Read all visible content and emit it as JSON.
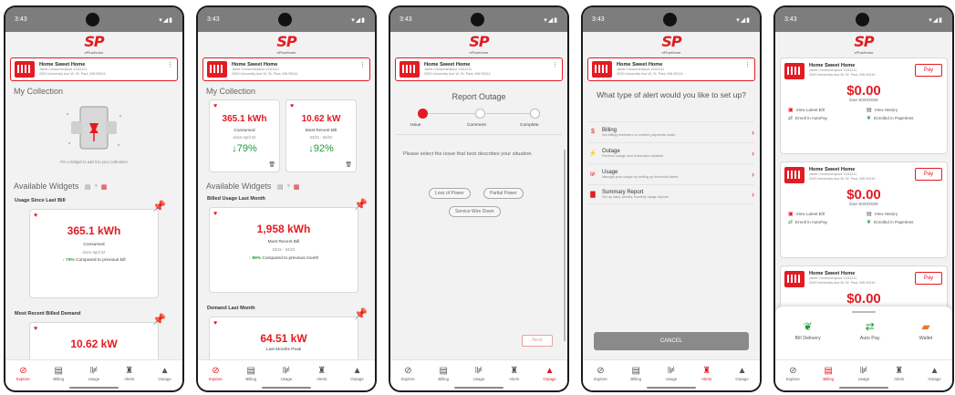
{
  "status_time": "3:43",
  "status_signal": "▾◢▮",
  "logo": {
    "text": "SP",
    "sub": "ePlusHome"
  },
  "account": {
    "name": "Home Sweet Home",
    "line1": "Janet Consumer|Acct 11111111",
    "line2": "2000 University Ave W, St. Paul, MN 55114"
  },
  "nav": {
    "explore": "Explore",
    "billing": "Billing",
    "usage": "Usage",
    "alerts": "Alerts",
    "outage": "Outage"
  },
  "s1": {
    "collection_title": "My Collection",
    "pin_hint": "Pin a Widget to add it to your collection!",
    "available_title": "Available Widgets",
    "w1_title": "Usage Since Last Bill",
    "w1_value": "365.1 kWh",
    "w1_label": "Consumed",
    "w1_since": "since April 22",
    "w1_pct": "↓ 79%",
    "w1_compare": "Compared to previous bill",
    "w2_title": "Most Recent Billed Demand",
    "w2_value": "10.62 kW"
  },
  "s2": {
    "collection_title": "My Collection",
    "c1_value": "365.1 kWh",
    "c1_label": "Consumed",
    "c1_since": "since April 22",
    "c1_pct": "↓79%",
    "c2_value": "10.62 kW",
    "c2_label": "Most Recent Bill",
    "c2_range": "03/21 - 04/22",
    "c2_pct": "↓92%",
    "available_title": "Available Widgets",
    "w1_title": "Billed Usage Last Month",
    "w1_value": "1,958 kWh",
    "w1_label": "Most Recent Bill",
    "w1_range": "03/21 - 04/22",
    "w1_pct": "↓ 89%",
    "w1_compare": "Compared to previous month",
    "w2_title": "Demand Last Month",
    "w2_value": "64.51 kW",
    "w2_label": "Last Months Peak"
  },
  "s3": {
    "title": "Report Outage",
    "step1": "Issue",
    "step2": "Comment",
    "step3": "Complete",
    "prompt": "Please select the issue that best describes your situation.",
    "opt1": "Loss of Power",
    "opt2": "Partial Power",
    "opt3": "Service Wire Down",
    "next": "Next"
  },
  "s4": {
    "question": "What type of alert would you like to set up?",
    "a1_title": "Billing",
    "a1_sub": "Set billing reminders or confirm payments made",
    "a2_title": "Outage",
    "a2_sub": "Receive outage and restoration updates",
    "a3_title": "Usage",
    "a3_sub": "Manage your usage by setting up threshold alerts",
    "a4_title": "Summary Report",
    "a4_sub": "Set up daily, weekly, monthly usage reports",
    "cancel": "CANCEL"
  },
  "s5": {
    "pay": "Pay",
    "amount": "$0.00",
    "due": "Due 5/20/2025",
    "view_bill": "View Latest Bill",
    "view_history": "View History",
    "autopay": "Enroll in AutoPay",
    "paperless": "Enrolled in Paperless",
    "sheet_bill_delivery": "Bill Delivery",
    "sheet_autopay": "Auto Pay",
    "sheet_wallet": "Wallet"
  }
}
